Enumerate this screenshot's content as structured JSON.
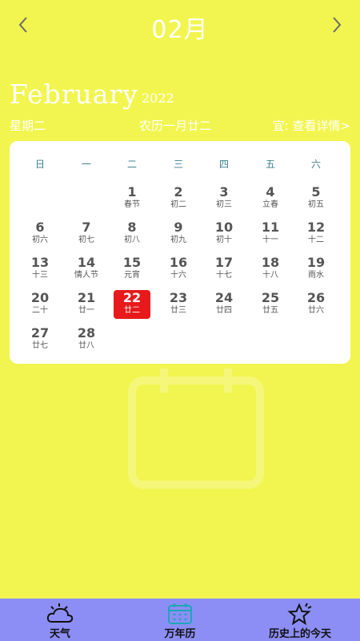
{
  "header": {
    "month_title": "02月"
  },
  "month_en": "February",
  "year_en": "2022",
  "info": {
    "weekday": "星期二",
    "lunar_date": "农历一月廿二",
    "details_link": "宜: 查看详情>"
  },
  "weekdays": [
    "日",
    "一",
    "二",
    "三",
    "四",
    "五",
    "六"
  ],
  "days": [
    {
      "n": "1",
      "l": "春节"
    },
    {
      "n": "2",
      "l": "初二"
    },
    {
      "n": "3",
      "l": "初三"
    },
    {
      "n": "4",
      "l": "立春"
    },
    {
      "n": "5",
      "l": "初五"
    },
    {
      "n": "6",
      "l": "初六"
    },
    {
      "n": "7",
      "l": "初七"
    },
    {
      "n": "8",
      "l": "初八"
    },
    {
      "n": "9",
      "l": "初九"
    },
    {
      "n": "10",
      "l": "初十"
    },
    {
      "n": "11",
      "l": "十一"
    },
    {
      "n": "12",
      "l": "十二"
    },
    {
      "n": "13",
      "l": "十三"
    },
    {
      "n": "14",
      "l": "情人节"
    },
    {
      "n": "15",
      "l": "元宵"
    },
    {
      "n": "16",
      "l": "十六"
    },
    {
      "n": "17",
      "l": "十七"
    },
    {
      "n": "18",
      "l": "十八"
    },
    {
      "n": "19",
      "l": "雨水"
    },
    {
      "n": "20",
      "l": "二十"
    },
    {
      "n": "21",
      "l": "廿一"
    },
    {
      "n": "22",
      "l": "廿二"
    },
    {
      "n": "23",
      "l": "廿三"
    },
    {
      "n": "24",
      "l": "廿四"
    },
    {
      "n": "25",
      "l": "廿五"
    },
    {
      "n": "26",
      "l": "廿六"
    },
    {
      "n": "27",
      "l": "廿七"
    },
    {
      "n": "28",
      "l": "廿八"
    }
  ],
  "selected_day": "22",
  "first_weekday_index": 2,
  "tabs": [
    {
      "label": "天气",
      "icon": "weather-cloud-sun-icon"
    },
    {
      "label": "万年历",
      "icon": "calendar-icon"
    },
    {
      "label": "历史上的今天",
      "icon": "star-icon"
    }
  ],
  "colors": {
    "background": "#F2F54F",
    "selected": "#E8191A",
    "bottom_bar": "#8C8EF5",
    "active_tab_icon": "#1FA6B8"
  }
}
